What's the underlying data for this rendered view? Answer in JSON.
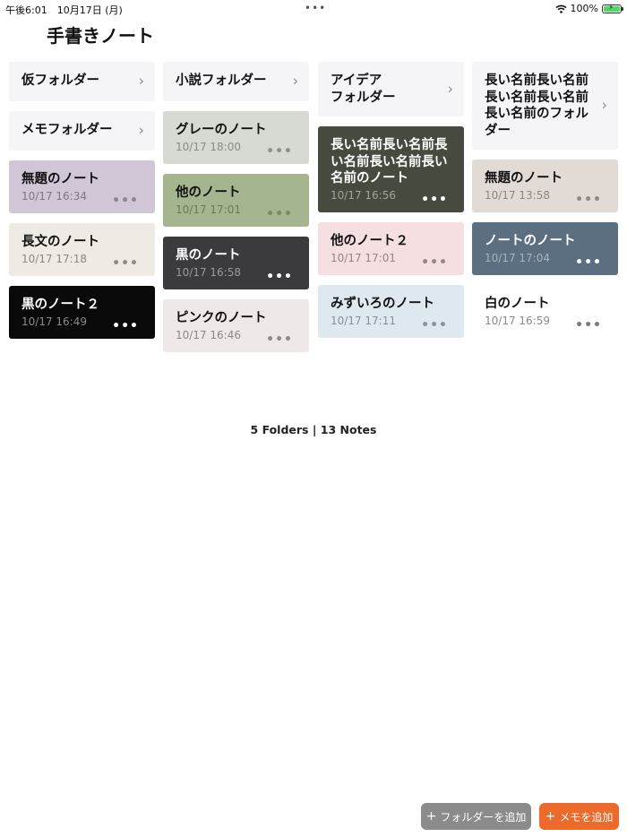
{
  "statusbar": {
    "time_date": "午後6:01　10月17日 (月)",
    "dots": "•••",
    "battery": "100%",
    "battery_level": 1.0
  },
  "app": {
    "title": "手書きノート"
  },
  "summary": "5 Folders | 13 Notes",
  "buttons": {
    "add_folder": "フォルダーを追加",
    "add_memo": "メモを追加",
    "plus": "+"
  },
  "icons": {
    "more": "•••",
    "chevron": "›"
  },
  "columns": [
    [
      {
        "type": "folder",
        "title": "仮フォルダー"
      },
      {
        "type": "folder",
        "title": "メモフォルダー"
      },
      {
        "type": "note",
        "title": "無題のノート",
        "date": "10/17 16:34",
        "bg": "#d0c6d6",
        "text": "#111111",
        "date_color": "#7e7884",
        "more_color": "#8c8691"
      },
      {
        "type": "note",
        "title": "長文のノート",
        "date": "10/17 17:18",
        "bg": "#efebe4",
        "text": "#111111",
        "date_color": "#8a8781",
        "more_color": "#8f8c87"
      },
      {
        "type": "note",
        "title": "黒のノート２",
        "date": "10/17 16:49",
        "bg": "#090909",
        "text": "#ffffff",
        "date_color": "#8a8a8a",
        "more_color": "#ffffff"
      }
    ],
    [
      {
        "type": "folder",
        "title": "小説フォルダー"
      },
      {
        "type": "note",
        "title": "グレーのノート",
        "date": "10/17 18:00",
        "bg": "#d7d9d3",
        "text": "#111111",
        "date_color": "#8a8c87",
        "more_color": "#8f918c"
      },
      {
        "type": "note",
        "title": "他のノート",
        "date": "10/17 17:01",
        "bg": "#a4b58f",
        "text": "#111111",
        "date_color": "#6b7a5b",
        "more_color": "#7a8a67"
      },
      {
        "type": "note",
        "title": "黒のノート",
        "date": "10/17 16:58",
        "bg": "#3b3a3c",
        "text": "#ffffff",
        "date_color": "#9a999b",
        "more_color": "#ffffff"
      },
      {
        "type": "note",
        "title": "ピンクのノート",
        "date": "10/17 16:46",
        "bg": "#efe8e8",
        "text": "#111111",
        "date_color": "#8c8686",
        "more_color": "#908a8a"
      }
    ],
    [
      {
        "type": "folder",
        "title": "アイデア\nフォルダー"
      },
      {
        "type": "note",
        "title": "長い名前長い名前長い名前長い名前長い名前のノート",
        "date": "10/17 16:56",
        "bg": "#474a3f",
        "text": "#ffffff",
        "date_color": "#a3a59d",
        "more_color": "#ffffff"
      },
      {
        "type": "note",
        "title": "他のノート２",
        "date": "10/17 17:01",
        "bg": "#f5dfe0",
        "text": "#111111",
        "date_color": "#928586",
        "more_color": "#958889"
      },
      {
        "type": "note",
        "title": "みずいろのノート",
        "date": "10/17 17:11",
        "bg": "#dde9ee",
        "text": "#111111",
        "date_color": "#86909a",
        "more_color": "#8a949a"
      }
    ],
    [
      {
        "type": "folder",
        "title": "長い名前長い名前長い名前長い名前長い名前のフォルダー"
      },
      {
        "type": "note",
        "title": "無題のノート",
        "date": "10/17 13:58",
        "bg": "#e2dad4",
        "text": "#111111",
        "date_color": "#8b8681",
        "more_color": "#8f8a85"
      },
      {
        "type": "note",
        "title": "ノートのノート",
        "date": "10/17 17:04",
        "bg": "#5b6f80",
        "text": "#ffffff",
        "date_color": "#a7b3bd",
        "more_color": "#ffffff"
      },
      {
        "type": "note",
        "title": "白のノート",
        "date": "10/17 16:59",
        "bg": "#ffffff",
        "text": "#111111",
        "date_color": "#8a8a8a",
        "more_color": "#7a7a7a"
      }
    ]
  ]
}
